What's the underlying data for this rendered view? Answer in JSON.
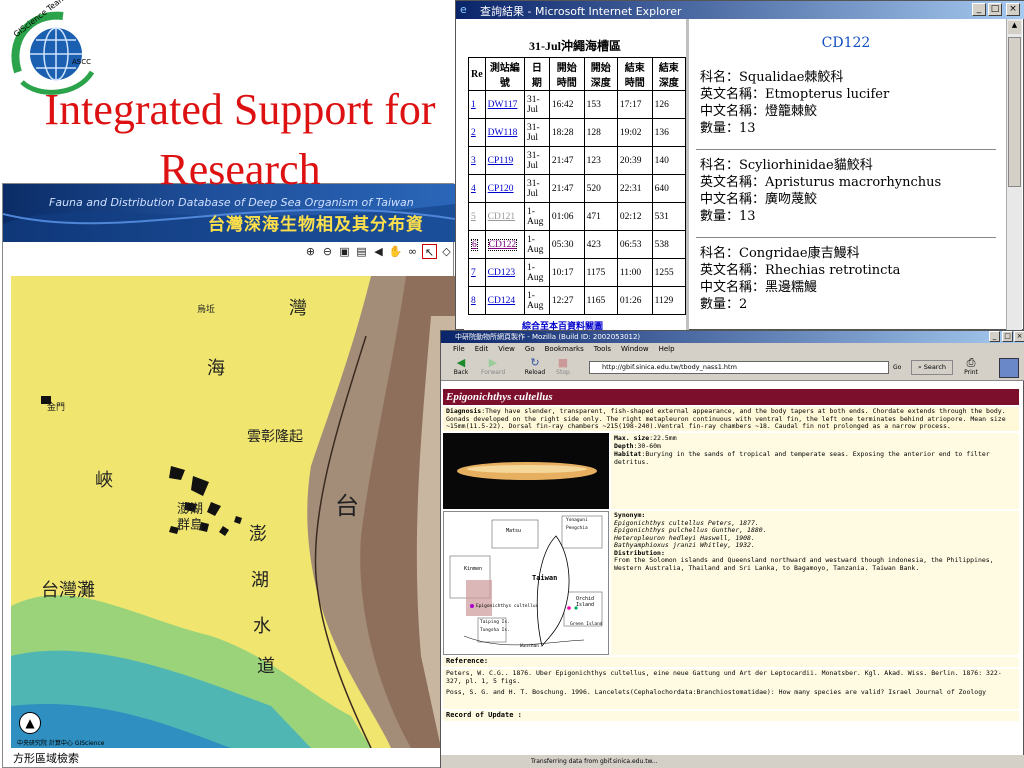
{
  "slide": {
    "title_line1": "Integrated Support for",
    "title_line2": "Research",
    "logo_text_top": "GIScience Team",
    "logo_text_bottom": "ASCC"
  },
  "map_window": {
    "banner_en": "Fauna and Distribution Database of Deep Sea Organism of Taiwan",
    "banner_zh": "台灣深海生物相及其分布資",
    "toolbar_icons": [
      "zoom-in-icon",
      "zoom-out-icon",
      "layer-icon",
      "print-icon",
      "back-icon",
      "pan-icon",
      "binoculars-icon",
      "select-icon",
      "erase-icon"
    ],
    "labels": [
      "灣",
      "烏坵",
      "海",
      "金門",
      "雲彰隆起",
      "峽",
      "澎湖",
      "群島",
      "澎",
      "湖",
      "水",
      "道",
      "台灣灘",
      "台"
    ],
    "footer": "方形區域檢索",
    "credit": "中央研究院 計算中心 GIScience"
  },
  "ie_window": {
    "title": "查詢結果 - Microsoft Internet Explorer",
    "table_title": "31-Jul沖繩海槽區",
    "columns": [
      "Re",
      "測站編號",
      "日期",
      "開始時間",
      "開始深度",
      "結束時間",
      "結束深度"
    ],
    "rows": [
      {
        "no": "1",
        "code": "DW117",
        "date": "31-Jul",
        "start": "16:42",
        "sdepth": "153",
        "end": "17:17",
        "edepth": "126",
        "state": ""
      },
      {
        "no": "2",
        "code": "DW118",
        "date": "31-Jul",
        "start": "18:28",
        "sdepth": "128",
        "end": "19:02",
        "edepth": "136",
        "state": ""
      },
      {
        "no": "3",
        "code": "CP119",
        "date": "31-Jul",
        "start": "21:47",
        "sdepth": "123",
        "end": "20:39",
        "edepth": "140",
        "state": ""
      },
      {
        "no": "4",
        "code": "CP120",
        "date": "31-Jul",
        "start": "21:47",
        "sdepth": "520",
        "end": "22:31",
        "edepth": "640",
        "state": ""
      },
      {
        "no": "5",
        "code": "CD121",
        "date": "1-Aug",
        "start": "01:06",
        "sdepth": "471",
        "end": "02:12",
        "edepth": "531",
        "state": "visited"
      },
      {
        "no": "6",
        "code": "CD122",
        "date": "1-Aug",
        "start": "05:30",
        "sdepth": "423",
        "end": "06:53",
        "edepth": "538",
        "state": "current"
      },
      {
        "no": "7",
        "code": "CD123",
        "date": "1-Aug",
        "start": "10:17",
        "sdepth": "1175",
        "end": "11:00",
        "edepth": "1255",
        "state": ""
      },
      {
        "no": "8",
        "code": "CD124",
        "date": "1-Aug",
        "start": "12:27",
        "sdepth": "1165",
        "end": "01:26",
        "edepth": "1129",
        "state": ""
      }
    ],
    "bottom_link": "綜合至本百資料關圖",
    "station_code": "CD122",
    "species": [
      {
        "family": "科名：Squalidae棘鮫科",
        "en": "英文名稱：Etmopterus lucifer",
        "zh": "中文名稱：燈籠棘鮫",
        "count": "數量：13"
      },
      {
        "family": "科名：Scyliorhinidae貓鮫科",
        "en": "英文名稱：Apristurus macrorhynchus",
        "zh": "中文名稱：廣吻蔑鮫",
        "count": "數量：13"
      },
      {
        "family": "科名：Congridae康吉鰻科",
        "en": "英文名稱：Rhechias retrotincta",
        "zh": "中文名稱：黑邊糯鰻",
        "count": "數量：2"
      }
    ]
  },
  "moz_window": {
    "title": "中研院動物所網頁製作 - Mozilla (Build ID: 2002053012)",
    "menu": [
      "File",
      "Edit",
      "View",
      "Go",
      "Bookmarks",
      "Tools",
      "Window",
      "Help"
    ],
    "nav": {
      "back": "Back",
      "forward": "Forward",
      "reload": "Reload",
      "stop": "Stop",
      "go": "Go",
      "search": "Search",
      "print": "Print"
    },
    "url": "http://gbif.sinica.edu.tw/tbody_nass1.htm",
    "species_name": "Epigonichthys cultellus",
    "diagnosis_label": "Diagnosis",
    "diagnosis": ":They have slender, transparent, fish-shaped external appearance, and the body tapers at both ends. Chordate extends through the body. Gonads developed on the right side only. The right metapleuron continuous with ventral fin, the left one terminates behind atriopore. Mean size ~15mm(11.5-22). Dorsal fin-ray chambers ~215(198-240).Ventral fin-ray chambers ~18. Caudal fin not prolonged as a narrow process.",
    "max_size_label": "Max. size",
    "max_size": ":22.5mm",
    "depth_label": "Depth",
    "depth": ":30-60m",
    "habitat_label": "Habitat",
    "habitat": ":Burying in the sands of tropical and temperate seas. Exposing the anterior end to filter detritus.",
    "synonyms_label": "Synonym:",
    "synonyms": [
      "Epigonichthys cultellus Peters, 1877.",
      "Epigonichthys pulchellus Gunther, 1880.",
      "Heteropleuron hedleyi Haswell, 1908.",
      "Bathyamphioxus jranzi Whitley, 1932."
    ],
    "distribution_label": "Distribution:",
    "distribution": "From the Solomon islands and Queensland northward and westward though indonesia, the Philippines, Western Australia, Thailand and Sri Lanka, to Bagamoyo, Tanzania. Taiwan Bank.",
    "minimap_labels": [
      "Matsu",
      "Taiwan",
      "Kinmen",
      "Orchid Island",
      "Epigonichthys cultellus",
      "Yonaguni",
      "Pengchia",
      "Green Island",
      "Taiping Is.",
      "Tungsha Is.",
      "Wanshan"
    ],
    "reference_label": "Reference:",
    "references": [
      "Peters, W. C.G.. 1876. Uber Epigonichthys cultellus, eine neue Gattung und Art der Leptocardii. Monatsber. Kgl. Akad. Wiss. Berlin. 1876: 322-327, pl. 1, 5 figs.",
      "Poss, S. G. and H. T. Boschung. 1996. Lancelets(Cephalochordata:Branchiostomatidae): How many species are valid? Israel Journal of Zoology"
    ],
    "record_label": "Record of Update :",
    "status": "Transferring data from gbif.sinica.edu.tw..."
  }
}
